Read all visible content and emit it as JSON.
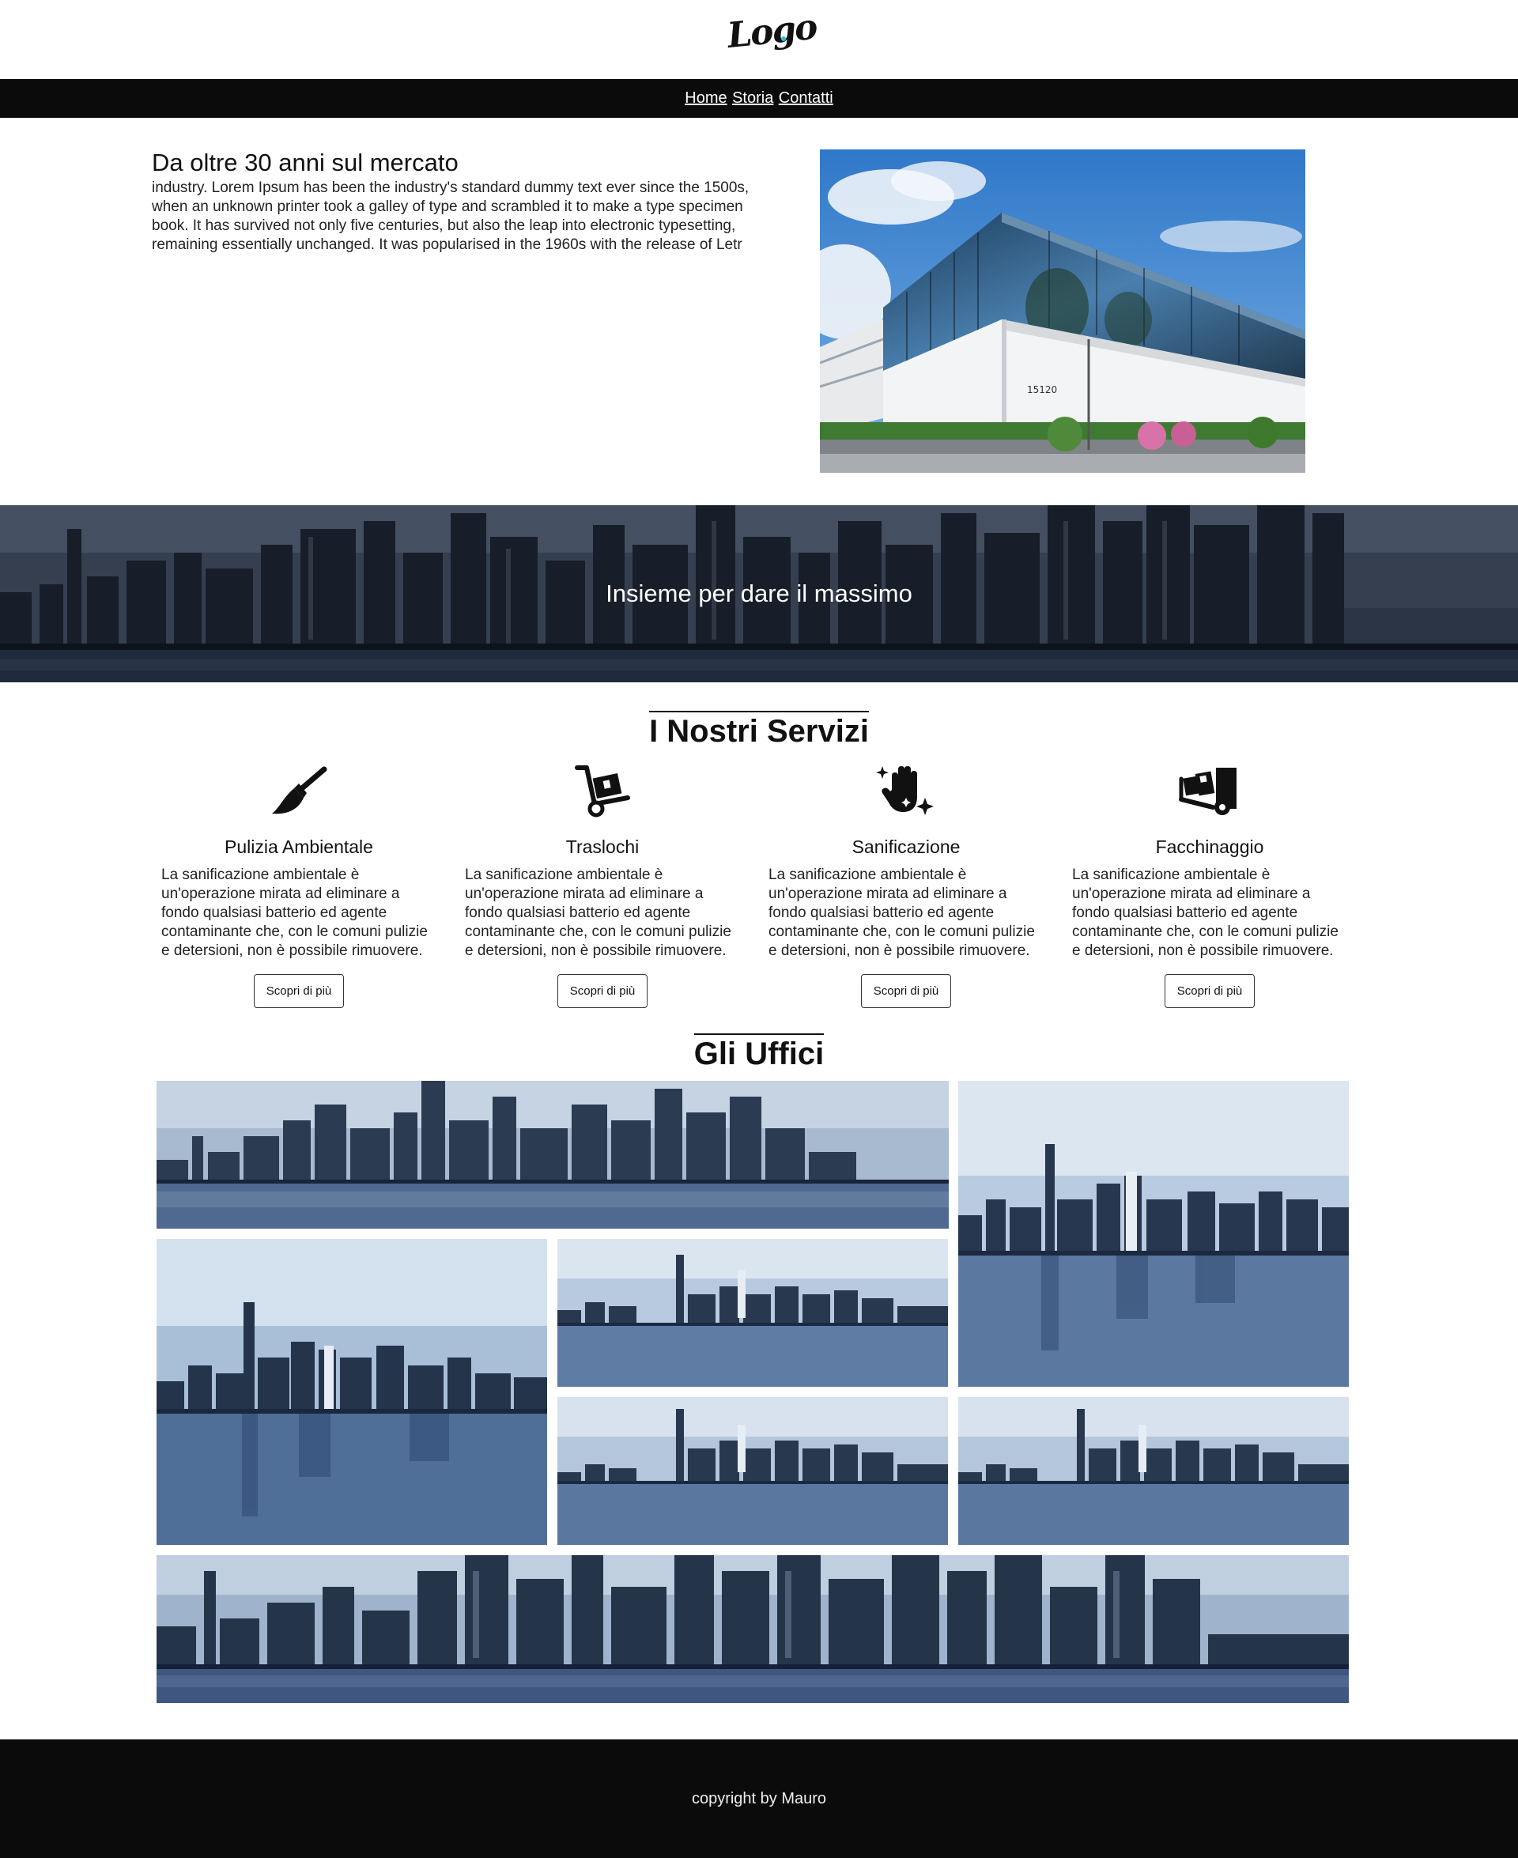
{
  "header": {
    "logo_text": "Logo"
  },
  "nav": {
    "items": [
      "Home",
      "Storia",
      "Contatti"
    ]
  },
  "intro": {
    "title": "Da oltre 30 anni sul mercato",
    "text": "industry. Lorem Ipsum has been the industry's standard dummy text ever since the 1500s, when an unknown printer took a galley of type and scrambled it to make a type specimen book. It has survived not only five centuries, but also the leap into electronic typesetting, remaining essentially unchanged. It was popularised in the 1960s with the release of Letr",
    "image_label": "15120"
  },
  "banner": {
    "caption": "Insieme per dare il massimo"
  },
  "services": {
    "title": "I Nostri Servizi",
    "items": [
      {
        "title": "Pulizia Ambientale",
        "icon": "broom-icon",
        "text": "La sanificazione ambientale è un'operazione mirata ad eliminare a fondo qualsiasi batterio ed agente contaminante che, con le comuni pulizie e detersioni, non è possibile rimuovere.",
        "button": "Scopri di più"
      },
      {
        "title": "Traslochi",
        "icon": "dolly-icon",
        "text": "La sanificazione ambientale è un'operazione mirata ad eliminare a fondo qualsiasi batterio ed agente contaminante che, con le comuni pulizie e detersioni, non è possibile rimuovere.",
        "button": "Scopri di più"
      },
      {
        "title": "Sanificazione",
        "icon": "sparkle-hand-icon",
        "text": "La sanificazione ambientale è un'operazione mirata ad eliminare a fondo qualsiasi batterio ed agente contaminante che, con le comuni pulizie e detersioni, non è possibile rimuovere.",
        "button": "Scopri di più"
      },
      {
        "title": "Facchinaggio",
        "icon": "truck-loading-icon",
        "text": "La sanificazione ambientale è un'operazione mirata ad eliminare a fondo qualsiasi batterio ed agente contaminante che, con le comuni pulizie e detersioni, non è possibile rimuovere.",
        "button": "Scopri di più"
      }
    ]
  },
  "gallery": {
    "title": "Gli Uffici"
  },
  "footer": {
    "text": "copyright by Mauro"
  },
  "colors": {
    "nav_bg": "#0b0b0c",
    "footer_bg": "#0b0b0c",
    "logo_dot": "#29c4d8",
    "sky": "#8fb0d3"
  }
}
